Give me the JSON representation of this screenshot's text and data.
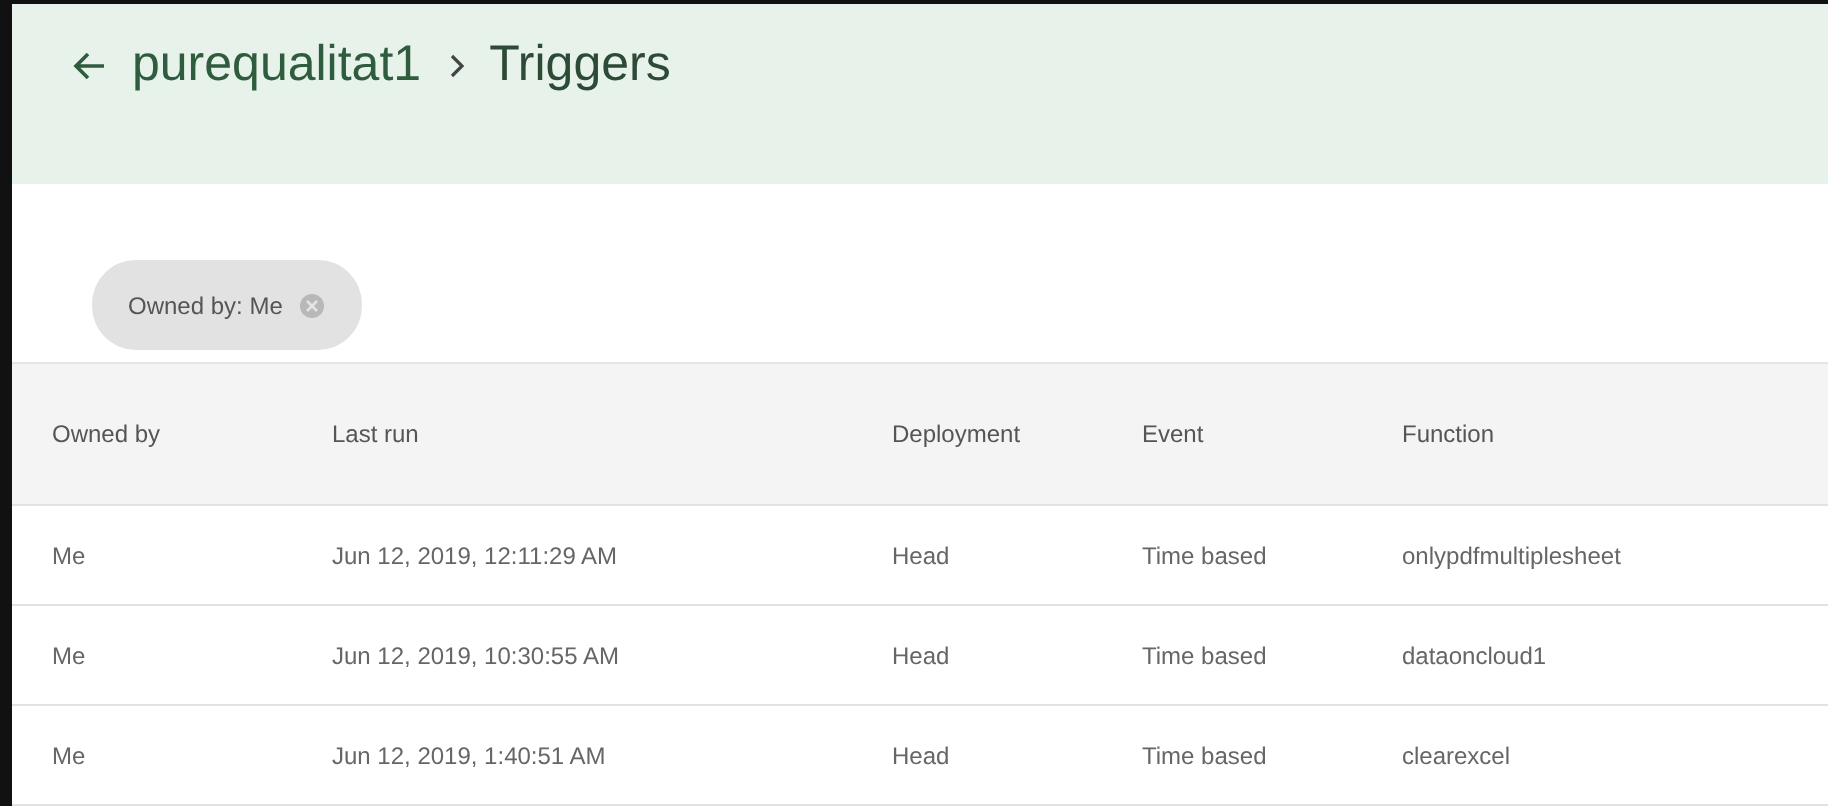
{
  "header": {
    "crumbs": [
      "purequalitat1",
      "Triggers"
    ]
  },
  "filter_chip": {
    "label": "Owned by: Me"
  },
  "table": {
    "columns": [
      "Owned by",
      "Last run",
      "Deployment",
      "Event",
      "Function"
    ],
    "rows": [
      [
        "Me",
        "Jun 12, 2019, 12:11:29 AM",
        "Head",
        "Time based",
        "onlypdfmultiplesheet"
      ],
      [
        "Me",
        "Jun 12, 2019, 10:30:55 AM",
        "Head",
        "Time based",
        "dataoncloud1"
      ],
      [
        "Me",
        "Jun 12, 2019, 1:40:51 AM",
        "Head",
        "Time based",
        "clearexcel"
      ]
    ]
  }
}
